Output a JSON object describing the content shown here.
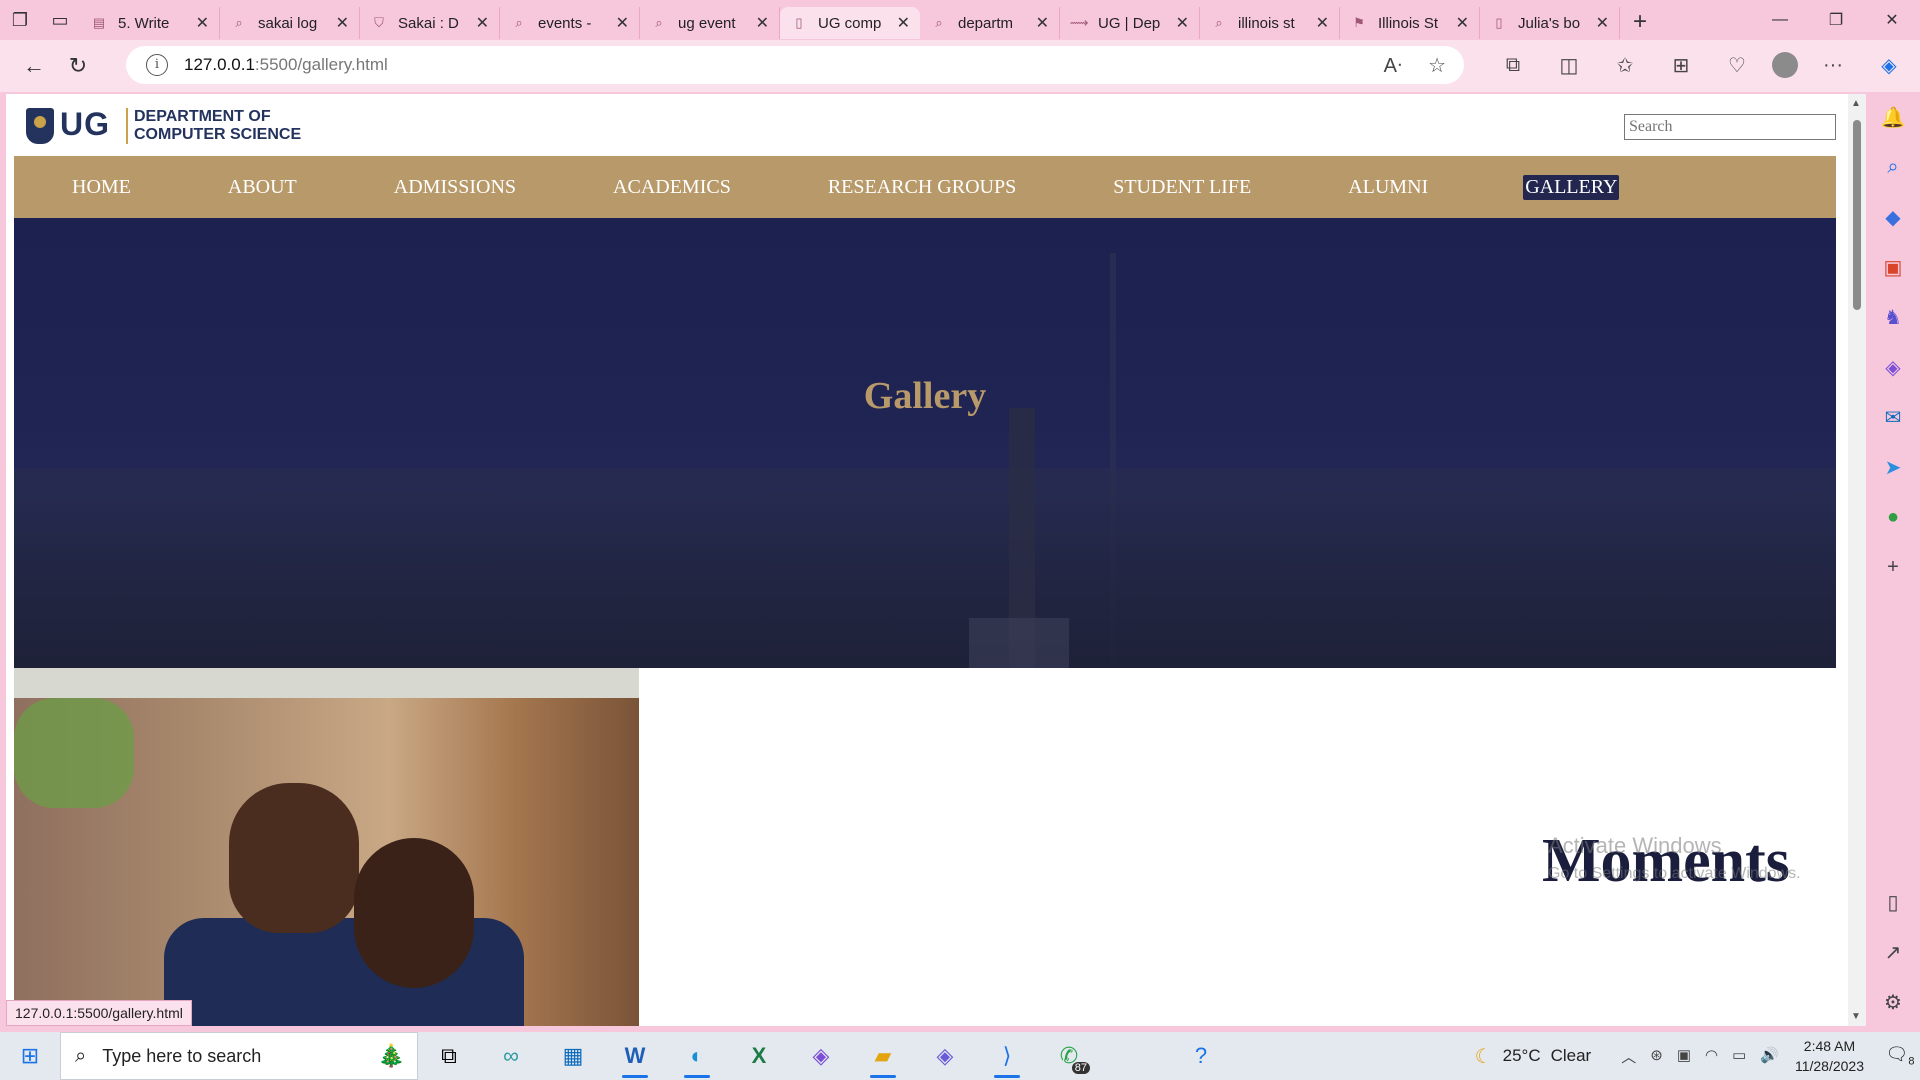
{
  "browser": {
    "tabs": [
      {
        "label": "5. Write",
        "icon": "page-icon",
        "active": false
      },
      {
        "label": "sakai log",
        "icon": "search-icon",
        "active": false
      },
      {
        "label": "Sakai : D",
        "icon": "shield-icon",
        "active": false
      },
      {
        "label": "events -",
        "icon": "search-icon",
        "active": false
      },
      {
        "label": "ug event",
        "icon": "search-icon",
        "active": false
      },
      {
        "label": "UG comp",
        "icon": "document-icon",
        "active": true
      },
      {
        "label": "departm",
        "icon": "search-icon",
        "active": false
      },
      {
        "label": "UG | Dep",
        "icon": "link-icon",
        "active": false
      },
      {
        "label": "illinois st",
        "icon": "search-icon",
        "active": false
      },
      {
        "label": "Illinois St",
        "icon": "flag-icon",
        "active": false
      },
      {
        "label": "Julia's bo",
        "icon": "document-icon",
        "active": false
      }
    ],
    "url_host": "127.0.0.1",
    "url_path": ":5500/gallery.html",
    "status_link": "127.0.0.1:5500/gallery.html"
  },
  "site": {
    "logo_text": "UG",
    "dept_line1": "DEPARTMENT OF",
    "dept_line2": "COMPUTER SCIENCE",
    "search_placeholder": "Search",
    "nav": [
      "HOME",
      "ABOUT",
      "ADMISSIONS",
      "ACADEMICS",
      "RESEARCH GROUPS",
      "STUDENT LIFE",
      "ALUMNI",
      "GALLERY"
    ],
    "active_nav": "GALLERY",
    "hero_title": "Gallery",
    "section_heading": "Moments"
  },
  "watermark": {
    "line1": "Activate Windows",
    "line2": "Go to Settings to activate Windows."
  },
  "taskbar": {
    "search_placeholder": "Type here to search",
    "whatsapp_badge": "87",
    "temperature": "25°C",
    "weather": "Clear",
    "time": "2:48 AM",
    "date": "11/28/2023",
    "notification_count": "8"
  },
  "colors": {
    "browser_chrome": "#f7c7dc",
    "nav_bar": "#b8996a",
    "hero_bg": "#1d214f",
    "accent_gold": "#b8996a",
    "brand_navy": "#23335e"
  }
}
